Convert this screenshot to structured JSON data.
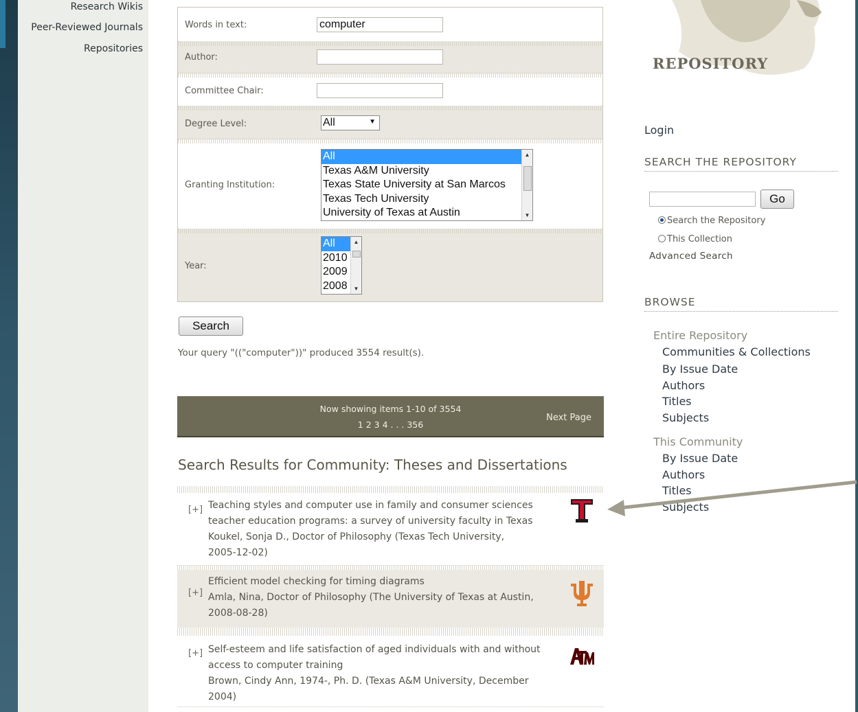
{
  "sidebar": {
    "items": [
      "Research Wikis",
      "Peer-Reviewed Journals",
      "Repositories"
    ]
  },
  "form": {
    "words_label": "Words in text:",
    "words_value": "computer",
    "author_label": "Author:",
    "author_value": "",
    "chair_label": "Committee Chair:",
    "chair_value": "",
    "degree_label": "Degree Level:",
    "degree_value": "All",
    "institution_label": "Granting Institution:",
    "institution_options": [
      "All",
      "Texas A&M University",
      "Texas State University at San Marcos",
      "Texas Tech University",
      "University of Texas at Austin"
    ],
    "year_label": "Year:",
    "year_options": [
      "All",
      "2010",
      "2009",
      "2008"
    ],
    "search_button": "Search"
  },
  "query_text": "Your query \"((\"computer\"))\" produced 3554 result(s).",
  "pager": {
    "showing": "Now showing items 1-10 of 3554",
    "pages": "1 2 3 4 . . . 356",
    "next": "Next Page"
  },
  "results": {
    "heading": "Search Results for Community: Theses and Dissertations",
    "toggle": "[+]",
    "items": [
      {
        "title_line1": "Teaching styles and computer use in family and consumer sciences",
        "title_line2": "teacher education programs: a survey of university faculty in Texas",
        "meta_line1": "Koukel, Sonja D., Doctor of Philosophy (Texas Tech University,",
        "meta_line2": "2005-12-02)",
        "logo": "texas-tech-logo",
        "logo_text": "T"
      },
      {
        "title_line1": "Efficient model checking for timing diagrams",
        "meta_line1": "Amla, Nina, Doctor of Philosophy (The University of Texas at Austin,",
        "meta_line2": "2008-08-28)",
        "logo": "ut-austin-logo"
      },
      {
        "title_line1": "Self-esteem and life satisfaction of aged individuals with and without",
        "title_line2": "access to computer training",
        "meta_line1": "Brown, Cindy Ann, 1974-, Ph. D. (Texas A&M University, December",
        "meta_line2": "2004)",
        "logo": "texas-am-logo",
        "logo_text": "ATM"
      }
    ]
  },
  "right": {
    "repo_title": "REPOSITORY",
    "login": "Login",
    "search_heading": "SEARCH THE REPOSITORY",
    "go_button": "Go",
    "radio_repository": "Search the Repository",
    "radio_collection": "This Collection",
    "advanced": "Advanced Search",
    "browse_heading": "BROWSE",
    "entire_repository": "Entire Repository",
    "entire_links": [
      "Communities & Collections",
      "By Issue Date",
      "Authors",
      "Titles",
      "Subjects"
    ],
    "this_community": "This Community",
    "community_links": [
      "By Issue Date",
      "Authors",
      "Titles",
      "Subjects"
    ]
  },
  "colors": {
    "pager_bg": "#6d6a55",
    "texas_tech_red": "#c8102e",
    "ut_orange": "#e07a2e",
    "tamu_maroon": "#500000",
    "annotation_arrow": "#a09d8e"
  }
}
